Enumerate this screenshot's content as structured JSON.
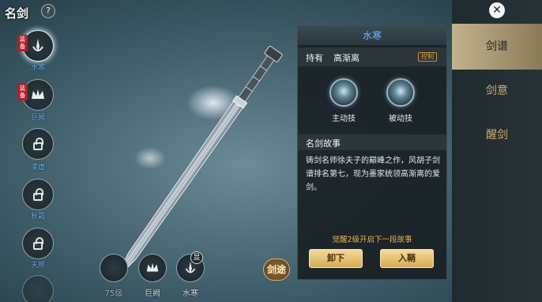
{
  "header": {
    "title": "名剑",
    "help_icon": "?"
  },
  "left_list": [
    {
      "label": "水寒",
      "equipped": true,
      "locked": false,
      "active": true
    },
    {
      "label": "巨阙",
      "equipped": true,
      "locked": false,
      "active": false
    },
    {
      "label": "凌虚",
      "equipped": false,
      "locked": true,
      "active": false
    },
    {
      "label": "秋霜",
      "equipped": false,
      "locked": true,
      "active": false
    },
    {
      "label": "天照",
      "equipped": false,
      "locked": true,
      "active": false
    }
  ],
  "equip_badge": "装备",
  "bottom_bar": [
    {
      "label": "75级",
      "icon": "lock-icon"
    },
    {
      "label": "巨阙",
      "icon": "sword-crown-icon"
    },
    {
      "label": "水寒",
      "icon": "sword-hand-icon"
    }
  ],
  "bottom_xian": "显",
  "jiantu_button": "剑途",
  "panel": {
    "title": "水寒",
    "holder_label": "持有",
    "holder_name": "高渐离",
    "control_badge": "控制",
    "skills": [
      {
        "label": "主动技"
      },
      {
        "label": "被动技"
      }
    ],
    "story_title": "名剑故事",
    "story_text": "铸剑名师徐夫子的巅峰之作，风胡子剑谱排名第七，现为墨家统领高渐离的爱剑。",
    "awake_tip": "觉醒2级开启下一段故事",
    "unequip_button": "卸下",
    "sheath_button": "入鞘"
  },
  "right_tabs": [
    {
      "label": "剑谱",
      "active": true
    },
    {
      "label": "剑意",
      "active": false
    },
    {
      "label": "醒剑",
      "active": false
    }
  ],
  "close_icon": "✕",
  "colors": {
    "accent_blue": "#6ab7ff",
    "gold": "#e8b455",
    "equip_red": "#b0202a"
  }
}
